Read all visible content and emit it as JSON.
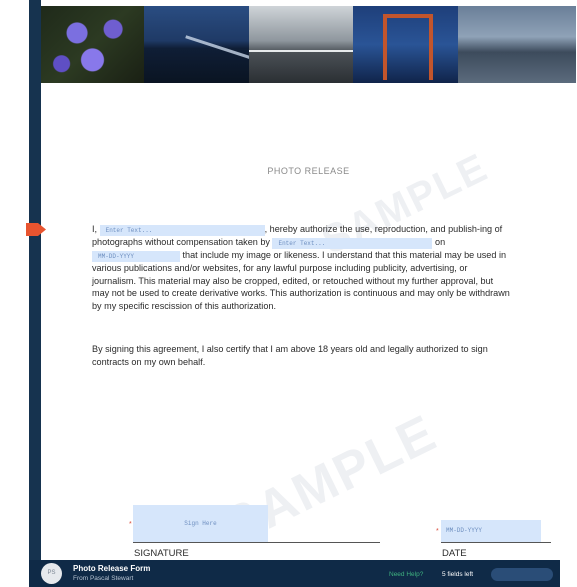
{
  "document": {
    "title": "PHOTO RELEASE",
    "watermark": "SAMPLE",
    "photos": [
      {
        "icon": "flowers-photo"
      },
      {
        "icon": "night-bridge-photo"
      },
      {
        "icon": "pier-photo"
      },
      {
        "icon": "red-bridge-photo"
      },
      {
        "icon": "bay-mountains-photo"
      }
    ],
    "paragraph1": {
      "t1": "I,",
      "name_field": "Enter Text...",
      "t2": ", hereby authorize the use, reproduction, and publish-ing of photographs without compensation taken by",
      "photographer_field": "Enter Text...",
      "t3": "on",
      "date_field": "MM-DD-YYYY",
      "t4": "that include my image or likeness. I understand that this material may be used in various publications and/or websites, for any lawful purpose including publicity, advertising, or journalism. This material may also be cropped, edited, or retouched without my further approval, but may not be used to create derivative works. This authorization is continuous and may only be withdrawn by my specific rescission of this authorization."
    },
    "paragraph2": "By signing this agreement, I also certify that I am above 18 years old and legally authorized to sign contracts on my own behalf.",
    "signature": {
      "required_mark": "*",
      "placeholder": "Sign Here",
      "label": "SIGNATURE"
    },
    "date": {
      "required_mark": "*",
      "placeholder": "MM-DD-YYYY",
      "label": "DATE"
    }
  },
  "footer": {
    "avatar_initials": "PS",
    "form_name": "Photo Release Form",
    "from": "From Pascal Stewart",
    "help": "Need Help?",
    "fields_left": "5 fields left"
  },
  "colors": {
    "frame": "#16334f",
    "field_fill": "#d6e6fb",
    "arrow": "#e8542f",
    "help": "#3fb27f"
  }
}
